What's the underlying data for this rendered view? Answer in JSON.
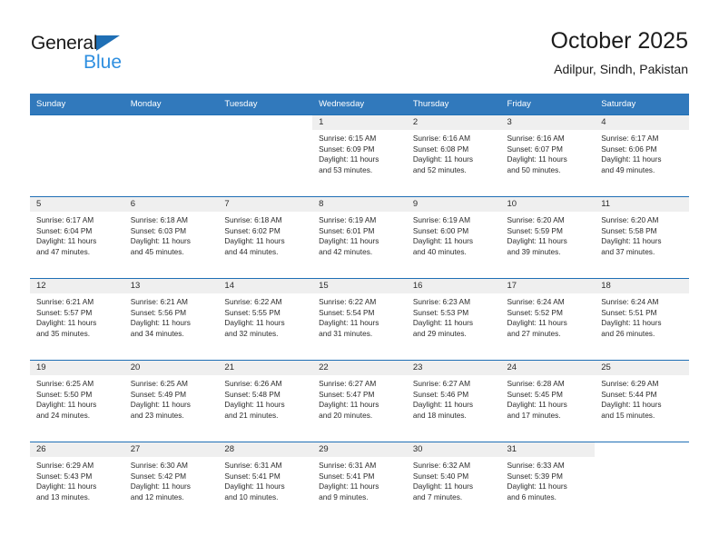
{
  "brand": {
    "name_part1": "General",
    "name_part2": "Blue",
    "triangle_color": "#1f6fb5",
    "blue_text_color": "#2e8fe0"
  },
  "header": {
    "title": "October 2025",
    "location": "Adilpur, Sindh, Pakistan"
  },
  "theme": {
    "header_row_bg": "#3179bc",
    "week_separator": "#1f6fb5",
    "daynum_band_bg": "#efefef",
    "text": "#2b2b2b"
  },
  "weekdays": [
    "Sunday",
    "Monday",
    "Tuesday",
    "Wednesday",
    "Thursday",
    "Friday",
    "Saturday"
  ],
  "weeks": [
    [
      {
        "day": "",
        "sunrise": "",
        "sunset": "",
        "daylight1": "",
        "daylight2": "",
        "blank": true
      },
      {
        "day": "",
        "sunrise": "",
        "sunset": "",
        "daylight1": "",
        "daylight2": "",
        "blank": true
      },
      {
        "day": "",
        "sunrise": "",
        "sunset": "",
        "daylight1": "",
        "daylight2": "",
        "blank": true
      },
      {
        "day": "1",
        "sunrise": "Sunrise: 6:15 AM",
        "sunset": "Sunset: 6:09 PM",
        "daylight1": "Daylight: 11 hours",
        "daylight2": "and 53 minutes."
      },
      {
        "day": "2",
        "sunrise": "Sunrise: 6:16 AM",
        "sunset": "Sunset: 6:08 PM",
        "daylight1": "Daylight: 11 hours",
        "daylight2": "and 52 minutes."
      },
      {
        "day": "3",
        "sunrise": "Sunrise: 6:16 AM",
        "sunset": "Sunset: 6:07 PM",
        "daylight1": "Daylight: 11 hours",
        "daylight2": "and 50 minutes."
      },
      {
        "day": "4",
        "sunrise": "Sunrise: 6:17 AM",
        "sunset": "Sunset: 6:06 PM",
        "daylight1": "Daylight: 11 hours",
        "daylight2": "and 49 minutes."
      }
    ],
    [
      {
        "day": "5",
        "sunrise": "Sunrise: 6:17 AM",
        "sunset": "Sunset: 6:04 PM",
        "daylight1": "Daylight: 11 hours",
        "daylight2": "and 47 minutes."
      },
      {
        "day": "6",
        "sunrise": "Sunrise: 6:18 AM",
        "sunset": "Sunset: 6:03 PM",
        "daylight1": "Daylight: 11 hours",
        "daylight2": "and 45 minutes."
      },
      {
        "day": "7",
        "sunrise": "Sunrise: 6:18 AM",
        "sunset": "Sunset: 6:02 PM",
        "daylight1": "Daylight: 11 hours",
        "daylight2": "and 44 minutes."
      },
      {
        "day": "8",
        "sunrise": "Sunrise: 6:19 AM",
        "sunset": "Sunset: 6:01 PM",
        "daylight1": "Daylight: 11 hours",
        "daylight2": "and 42 minutes."
      },
      {
        "day": "9",
        "sunrise": "Sunrise: 6:19 AM",
        "sunset": "Sunset: 6:00 PM",
        "daylight1": "Daylight: 11 hours",
        "daylight2": "and 40 minutes."
      },
      {
        "day": "10",
        "sunrise": "Sunrise: 6:20 AM",
        "sunset": "Sunset: 5:59 PM",
        "daylight1": "Daylight: 11 hours",
        "daylight2": "and 39 minutes."
      },
      {
        "day": "11",
        "sunrise": "Sunrise: 6:20 AM",
        "sunset": "Sunset: 5:58 PM",
        "daylight1": "Daylight: 11 hours",
        "daylight2": "and 37 minutes."
      }
    ],
    [
      {
        "day": "12",
        "sunrise": "Sunrise: 6:21 AM",
        "sunset": "Sunset: 5:57 PM",
        "daylight1": "Daylight: 11 hours",
        "daylight2": "and 35 minutes."
      },
      {
        "day": "13",
        "sunrise": "Sunrise: 6:21 AM",
        "sunset": "Sunset: 5:56 PM",
        "daylight1": "Daylight: 11 hours",
        "daylight2": "and 34 minutes."
      },
      {
        "day": "14",
        "sunrise": "Sunrise: 6:22 AM",
        "sunset": "Sunset: 5:55 PM",
        "daylight1": "Daylight: 11 hours",
        "daylight2": "and 32 minutes."
      },
      {
        "day": "15",
        "sunrise": "Sunrise: 6:22 AM",
        "sunset": "Sunset: 5:54 PM",
        "daylight1": "Daylight: 11 hours",
        "daylight2": "and 31 minutes."
      },
      {
        "day": "16",
        "sunrise": "Sunrise: 6:23 AM",
        "sunset": "Sunset: 5:53 PM",
        "daylight1": "Daylight: 11 hours",
        "daylight2": "and 29 minutes."
      },
      {
        "day": "17",
        "sunrise": "Sunrise: 6:24 AM",
        "sunset": "Sunset: 5:52 PM",
        "daylight1": "Daylight: 11 hours",
        "daylight2": "and 27 minutes."
      },
      {
        "day": "18",
        "sunrise": "Sunrise: 6:24 AM",
        "sunset": "Sunset: 5:51 PM",
        "daylight1": "Daylight: 11 hours",
        "daylight2": "and 26 minutes."
      }
    ],
    [
      {
        "day": "19",
        "sunrise": "Sunrise: 6:25 AM",
        "sunset": "Sunset: 5:50 PM",
        "daylight1": "Daylight: 11 hours",
        "daylight2": "and 24 minutes."
      },
      {
        "day": "20",
        "sunrise": "Sunrise: 6:25 AM",
        "sunset": "Sunset: 5:49 PM",
        "daylight1": "Daylight: 11 hours",
        "daylight2": "and 23 minutes."
      },
      {
        "day": "21",
        "sunrise": "Sunrise: 6:26 AM",
        "sunset": "Sunset: 5:48 PM",
        "daylight1": "Daylight: 11 hours",
        "daylight2": "and 21 minutes."
      },
      {
        "day": "22",
        "sunrise": "Sunrise: 6:27 AM",
        "sunset": "Sunset: 5:47 PM",
        "daylight1": "Daylight: 11 hours",
        "daylight2": "and 20 minutes."
      },
      {
        "day": "23",
        "sunrise": "Sunrise: 6:27 AM",
        "sunset": "Sunset: 5:46 PM",
        "daylight1": "Daylight: 11 hours",
        "daylight2": "and 18 minutes."
      },
      {
        "day": "24",
        "sunrise": "Sunrise: 6:28 AM",
        "sunset": "Sunset: 5:45 PM",
        "daylight1": "Daylight: 11 hours",
        "daylight2": "and 17 minutes."
      },
      {
        "day": "25",
        "sunrise": "Sunrise: 6:29 AM",
        "sunset": "Sunset: 5:44 PM",
        "daylight1": "Daylight: 11 hours",
        "daylight2": "and 15 minutes."
      }
    ],
    [
      {
        "day": "26",
        "sunrise": "Sunrise: 6:29 AM",
        "sunset": "Sunset: 5:43 PM",
        "daylight1": "Daylight: 11 hours",
        "daylight2": "and 13 minutes."
      },
      {
        "day": "27",
        "sunrise": "Sunrise: 6:30 AM",
        "sunset": "Sunset: 5:42 PM",
        "daylight1": "Daylight: 11 hours",
        "daylight2": "and 12 minutes."
      },
      {
        "day": "28",
        "sunrise": "Sunrise: 6:31 AM",
        "sunset": "Sunset: 5:41 PM",
        "daylight1": "Daylight: 11 hours",
        "daylight2": "and 10 minutes."
      },
      {
        "day": "29",
        "sunrise": "Sunrise: 6:31 AM",
        "sunset": "Sunset: 5:41 PM",
        "daylight1": "Daylight: 11 hours",
        "daylight2": "and 9 minutes."
      },
      {
        "day": "30",
        "sunrise": "Sunrise: 6:32 AM",
        "sunset": "Sunset: 5:40 PM",
        "daylight1": "Daylight: 11 hours",
        "daylight2": "and 7 minutes."
      },
      {
        "day": "31",
        "sunrise": "Sunrise: 6:33 AM",
        "sunset": "Sunset: 5:39 PM",
        "daylight1": "Daylight: 11 hours",
        "daylight2": "and 6 minutes."
      },
      {
        "day": "",
        "sunrise": "",
        "sunset": "",
        "daylight1": "",
        "daylight2": "",
        "blank": true
      }
    ]
  ]
}
